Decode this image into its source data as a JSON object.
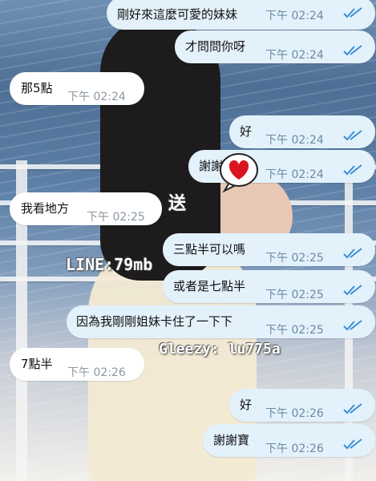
{
  "watermarks": {
    "line": "LINE:79mb",
    "send": "送",
    "gleezy": "Gleezy: lu775a"
  },
  "messages": [
    {
      "dir": "out",
      "text": "剛好來這麼可愛的妹妹",
      "time": "下午 02:24",
      "read": true
    },
    {
      "dir": "out",
      "text": "才問問你呀",
      "time": "下午 02:24",
      "read": true
    },
    {
      "dir": "in",
      "text": "那5點",
      "time": "下午 02:24"
    },
    {
      "dir": "out",
      "text": "好",
      "time": "下午 02:24",
      "read": true
    },
    {
      "dir": "out",
      "text": "謝謝",
      "time": "下午 02:24",
      "read": true,
      "sticker": "heart-sticker"
    },
    {
      "dir": "in",
      "text": "我看地方",
      "time": "下午 02:25"
    },
    {
      "dir": "out",
      "text": "三點半可以嗎",
      "time": "下午 02:25",
      "read": true
    },
    {
      "dir": "out",
      "text": "或者是七點半",
      "time": "下午 02:25",
      "read": true
    },
    {
      "dir": "out",
      "text": "因為我剛剛姐妹卡住了一下下",
      "time": "下午 02:25",
      "read": true
    },
    {
      "dir": "in",
      "text": "7點半",
      "time": "下午 02:26"
    },
    {
      "dir": "out",
      "text": "好",
      "time": "下午 02:26",
      "read": true
    },
    {
      "dir": "out",
      "text": "謝謝寶",
      "time": "下午 02:26",
      "read": true
    }
  ],
  "colors": {
    "outgoing": "#e3f1fb",
    "incoming": "#ffffff",
    "read_tick": "#3b8fd6"
  }
}
